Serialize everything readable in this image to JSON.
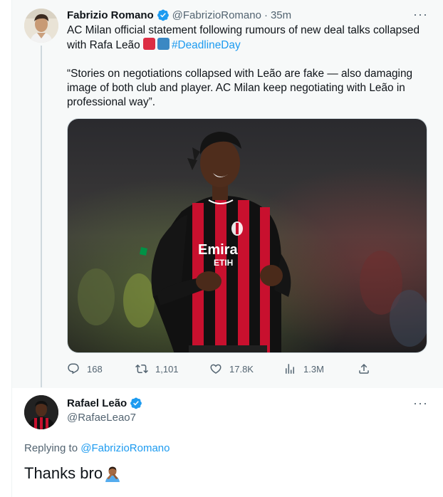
{
  "colors": {
    "accent": "#1d9bf0",
    "muted": "#536471",
    "text": "#0f1419",
    "milan_red": "#c8102e",
    "milan_black": "#111111"
  },
  "tweet": {
    "author_name": "Fabrizio Romano",
    "author_handle": "@FabrizioRomano",
    "separator": "·",
    "time": "35m",
    "more_label": "···",
    "line1": "AC Milan official statement following rumours of new deal talks collapsed with Rafa Leão",
    "hashtag": "#DeadlineDay",
    "quote": "“Stories on negotiations collapsed with Leão are fake — also damaging image of both club and player. AC Milan keep negotiating with Leão in professional way”.",
    "media": {
      "shirt_sponsor_line1": "Emira",
      "shirt_sponsor_line2": "ETIH"
    },
    "stats": {
      "replies": "168",
      "retweets": "1,101",
      "likes": "17.8K",
      "views": "1.3M"
    }
  },
  "reply": {
    "author_name": "Rafael Leão",
    "author_handle": "@RafaeLeao7",
    "more_label": "···",
    "replying_prefix": "Replying to",
    "replying_to": "@FabrizioRomano",
    "text": "Thanks bro"
  },
  "icons": {
    "verified": "verified-badge-icon",
    "reply": "reply-icon",
    "retweet": "retweet-icon",
    "like": "heart-icon",
    "views": "views-icon",
    "share": "share-icon",
    "facepalm": "person-facepalming-emoji",
    "alarm": "police-light-emoji",
    "arrow": "right-arrow-curving-down-emoji"
  }
}
